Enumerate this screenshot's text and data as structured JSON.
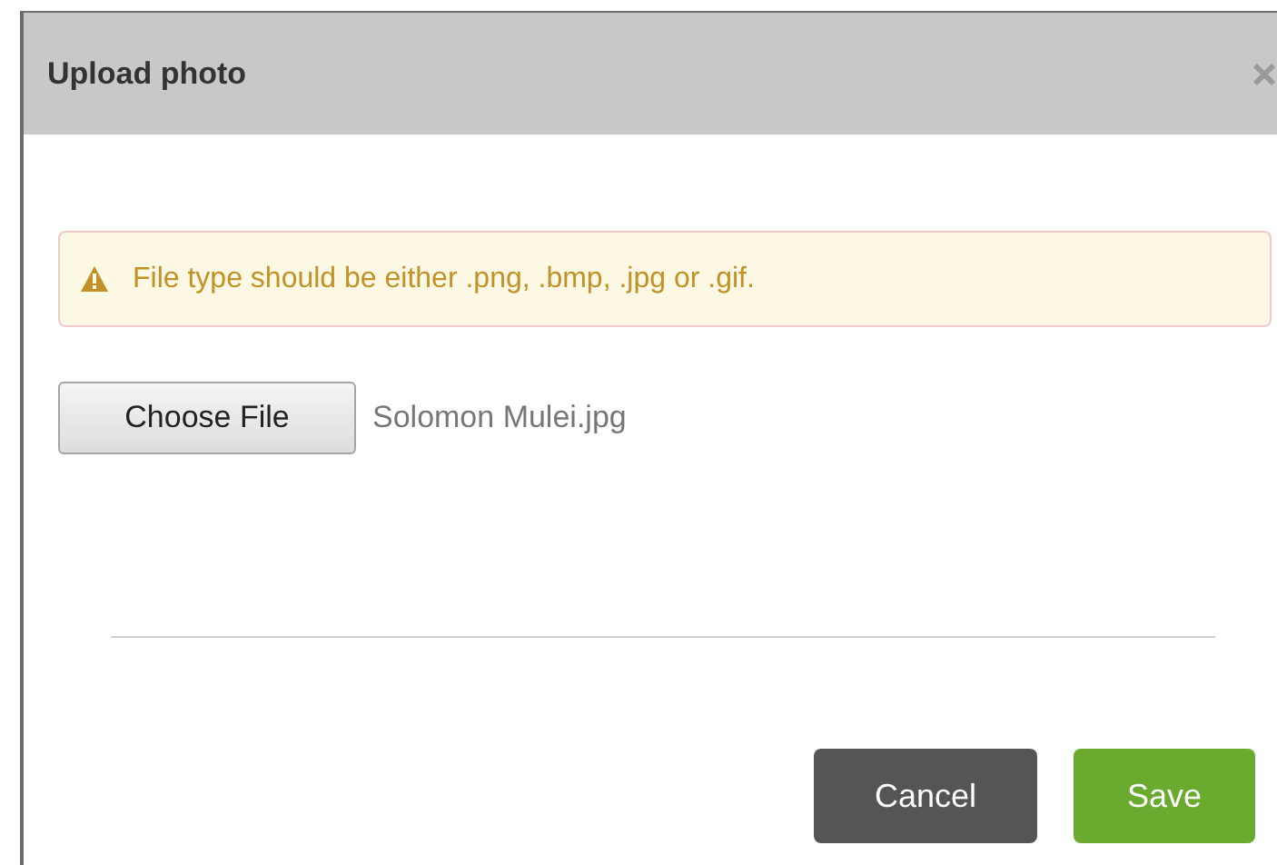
{
  "dialog": {
    "title": "Upload photo"
  },
  "alert": {
    "kind": "warning",
    "message": "File type should be either .png, .bmp, .jpg or .gif."
  },
  "file_input": {
    "button": "Choose File",
    "value": "Solomon Mulei.jpg"
  },
  "buttons": [
    {
      "label": "Cancel",
      "kind": "secondary"
    },
    {
      "label": "Save",
      "kind": "primary"
    }
  ]
}
